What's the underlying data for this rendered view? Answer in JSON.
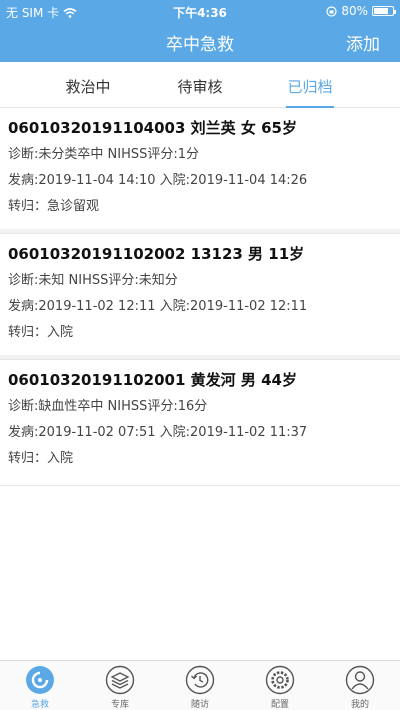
{
  "status_bar": {
    "carrier": "无 SIM 卡",
    "time": "下午4:36",
    "battery_pct": "80%",
    "battery_level": 0.8
  },
  "nav": {
    "title": "卒中急救",
    "add_label": "添加"
  },
  "tabs": [
    {
      "label": "救治中"
    },
    {
      "label": "待审核"
    },
    {
      "label": "已归档"
    }
  ],
  "active_tab": "已归档",
  "accent_color": "#5aa9e6",
  "records": [
    {
      "title": "06010320191104003  刘兰英  女  65岁",
      "diagnosis": "诊断:未分类卒中   NIHSS评分:1分",
      "times": "发病:2019-11-04 14:10  入院:2019-11-04 14:26",
      "outcome": "转归：急诊留观"
    },
    {
      "title": "06010320191102002  13123  男  11岁",
      "diagnosis": "诊断:未知   NIHSS评分:未知分",
      "times": "发病:2019-11-02 12:11  入院:2019-11-02 12:11",
      "outcome": "转归：入院"
    },
    {
      "title": "06010320191102001  黄发河  男  44岁",
      "diagnosis": "诊断:缺血性卒中   NIHSS评分:16分",
      "times": "发病:2019-11-02 07:51  入院:2019-11-02 11:37",
      "outcome": "转归：入院"
    }
  ],
  "tabbar": [
    {
      "label": "急救",
      "icon": "emergency-icon"
    },
    {
      "label": "专库",
      "icon": "layers-icon"
    },
    {
      "label": "随访",
      "icon": "follow-up-icon"
    },
    {
      "label": "配置",
      "icon": "gear-icon"
    },
    {
      "label": "我的",
      "icon": "user-icon"
    }
  ]
}
